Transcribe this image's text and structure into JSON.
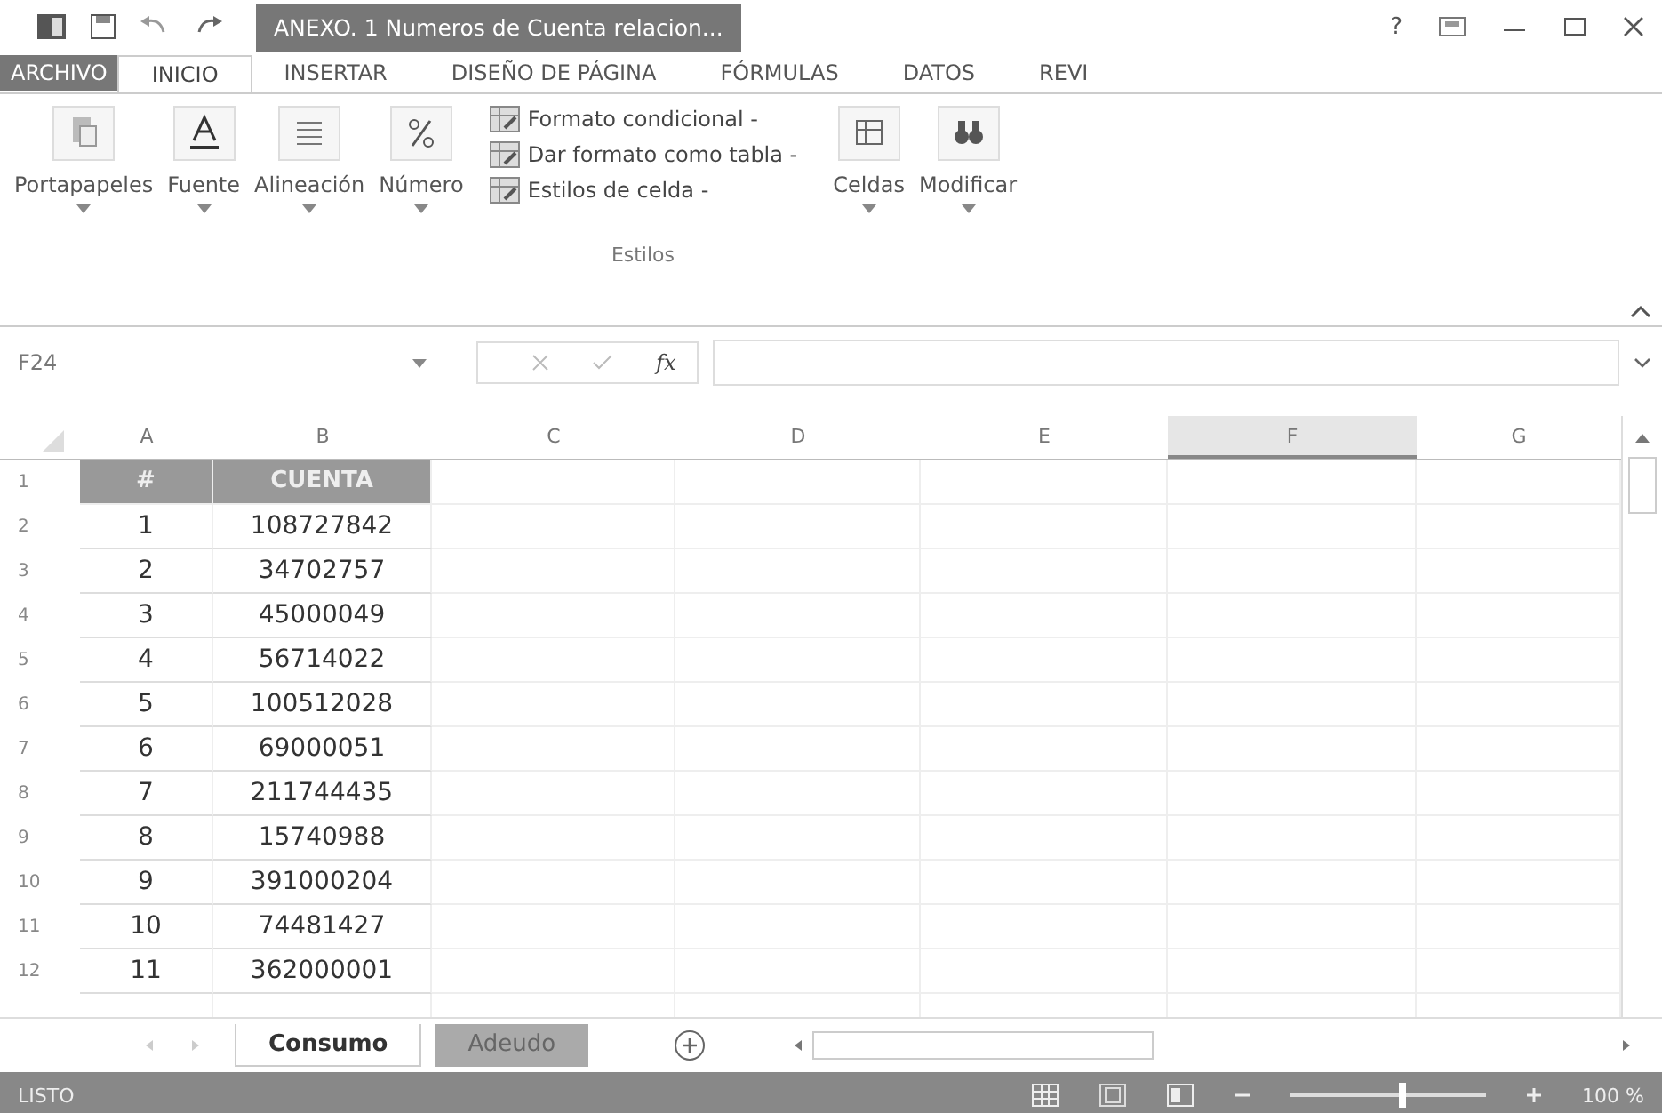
{
  "window": {
    "title": "ANEXO. 1 Numeros de Cuenta relacion...",
    "help": "?"
  },
  "ribbon_tabs": [
    {
      "label": "ARCHIVO",
      "selected": false,
      "kind": "file"
    },
    {
      "label": "INICIO",
      "selected": true,
      "kind": "tab"
    },
    {
      "label": "INSERTAR",
      "selected": false,
      "kind": "tab"
    },
    {
      "label": "DISEÑO DE PÁGINA",
      "selected": false,
      "kind": "tab"
    },
    {
      "label": "FÓRMULAS",
      "selected": false,
      "kind": "tab"
    },
    {
      "label": "DATOS",
      "selected": false,
      "kind": "tab"
    },
    {
      "label": "REVI",
      "selected": false,
      "kind": "tab"
    }
  ],
  "ribbon_groups": [
    {
      "label": "Portapapeles",
      "kind": "clipboard"
    },
    {
      "label": "Fuente",
      "kind": "font"
    },
    {
      "label": "Alineación",
      "kind": "align"
    },
    {
      "label": "Número",
      "kind": "number"
    }
  ],
  "styles_group": {
    "label": "Estilos",
    "items": [
      "Formato condicional -",
      "Dar formato como tabla -",
      "Estilos de celda -"
    ]
  },
  "ribbon_groups_right": [
    {
      "label": "Celdas",
      "kind": "cells"
    },
    {
      "label": "Modificar",
      "kind": "find"
    }
  ],
  "formula_bar": {
    "name_box": "F24",
    "fx": "fx"
  },
  "columns": [
    {
      "label": "A",
      "selected": false
    },
    {
      "label": "B",
      "selected": false
    },
    {
      "label": "C",
      "selected": false
    },
    {
      "label": "D",
      "selected": false
    },
    {
      "label": "E",
      "selected": false
    },
    {
      "label": "F",
      "selected": true
    },
    {
      "label": "G",
      "selected": false
    }
  ],
  "header_row": {
    "row": "1",
    "num": "#",
    "cuenta": "CUENTA"
  },
  "rows": [
    {
      "row": "2",
      "num": "1",
      "cuenta": "108727842"
    },
    {
      "row": "3",
      "num": "2",
      "cuenta": "34702757"
    },
    {
      "row": "4",
      "num": "3",
      "cuenta": "45000049"
    },
    {
      "row": "5",
      "num": "4",
      "cuenta": "56714022"
    },
    {
      "row": "6",
      "num": "5",
      "cuenta": "100512028"
    },
    {
      "row": "7",
      "num": "6",
      "cuenta": "69000051"
    },
    {
      "row": "8",
      "num": "7",
      "cuenta": "211744435"
    },
    {
      "row": "9",
      "num": "8",
      "cuenta": "15740988"
    },
    {
      "row": "10",
      "num": "9",
      "cuenta": "391000204"
    },
    {
      "row": "11",
      "num": "10",
      "cuenta": "74481427"
    },
    {
      "row": "12",
      "num": "11",
      "cuenta": "362000001"
    }
  ],
  "sheet_tabs": [
    {
      "label": "Consumo",
      "selected": true
    },
    {
      "label": "Adeudo",
      "selected": false
    }
  ],
  "status_bar": {
    "status": "LISTO",
    "zoom_text": "100 %",
    "zoom_slider": {
      "level": 0.55
    }
  }
}
